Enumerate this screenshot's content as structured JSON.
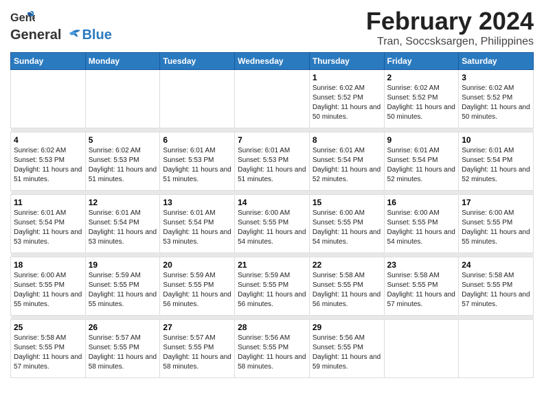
{
  "logo": {
    "general": "General",
    "blue": "Blue"
  },
  "title": "February 2024",
  "subtitle": "Tran, Soccsksargen, Philippines",
  "weekdays": [
    "Sunday",
    "Monday",
    "Tuesday",
    "Wednesday",
    "Thursday",
    "Friday",
    "Saturday"
  ],
  "weeks": [
    {
      "days": [
        {
          "num": "",
          "info": ""
        },
        {
          "num": "",
          "info": ""
        },
        {
          "num": "",
          "info": ""
        },
        {
          "num": "",
          "info": ""
        },
        {
          "num": "1",
          "info": "Sunrise: 6:02 AM\nSunset: 5:52 PM\nDaylight: 11 hours and 50 minutes."
        },
        {
          "num": "2",
          "info": "Sunrise: 6:02 AM\nSunset: 5:52 PM\nDaylight: 11 hours and 50 minutes."
        },
        {
          "num": "3",
          "info": "Sunrise: 6:02 AM\nSunset: 5:52 PM\nDaylight: 11 hours and 50 minutes."
        }
      ]
    },
    {
      "days": [
        {
          "num": "4",
          "info": "Sunrise: 6:02 AM\nSunset: 5:53 PM\nDaylight: 11 hours and 51 minutes."
        },
        {
          "num": "5",
          "info": "Sunrise: 6:02 AM\nSunset: 5:53 PM\nDaylight: 11 hours and 51 minutes."
        },
        {
          "num": "6",
          "info": "Sunrise: 6:01 AM\nSunset: 5:53 PM\nDaylight: 11 hours and 51 minutes."
        },
        {
          "num": "7",
          "info": "Sunrise: 6:01 AM\nSunset: 5:53 PM\nDaylight: 11 hours and 51 minutes."
        },
        {
          "num": "8",
          "info": "Sunrise: 6:01 AM\nSunset: 5:54 PM\nDaylight: 11 hours and 52 minutes."
        },
        {
          "num": "9",
          "info": "Sunrise: 6:01 AM\nSunset: 5:54 PM\nDaylight: 11 hours and 52 minutes."
        },
        {
          "num": "10",
          "info": "Sunrise: 6:01 AM\nSunset: 5:54 PM\nDaylight: 11 hours and 52 minutes."
        }
      ]
    },
    {
      "days": [
        {
          "num": "11",
          "info": "Sunrise: 6:01 AM\nSunset: 5:54 PM\nDaylight: 11 hours and 53 minutes."
        },
        {
          "num": "12",
          "info": "Sunrise: 6:01 AM\nSunset: 5:54 PM\nDaylight: 11 hours and 53 minutes."
        },
        {
          "num": "13",
          "info": "Sunrise: 6:01 AM\nSunset: 5:54 PM\nDaylight: 11 hours and 53 minutes."
        },
        {
          "num": "14",
          "info": "Sunrise: 6:00 AM\nSunset: 5:55 PM\nDaylight: 11 hours and 54 minutes."
        },
        {
          "num": "15",
          "info": "Sunrise: 6:00 AM\nSunset: 5:55 PM\nDaylight: 11 hours and 54 minutes."
        },
        {
          "num": "16",
          "info": "Sunrise: 6:00 AM\nSunset: 5:55 PM\nDaylight: 11 hours and 54 minutes."
        },
        {
          "num": "17",
          "info": "Sunrise: 6:00 AM\nSunset: 5:55 PM\nDaylight: 11 hours and 55 minutes."
        }
      ]
    },
    {
      "days": [
        {
          "num": "18",
          "info": "Sunrise: 6:00 AM\nSunset: 5:55 PM\nDaylight: 11 hours and 55 minutes."
        },
        {
          "num": "19",
          "info": "Sunrise: 5:59 AM\nSunset: 5:55 PM\nDaylight: 11 hours and 55 minutes."
        },
        {
          "num": "20",
          "info": "Sunrise: 5:59 AM\nSunset: 5:55 PM\nDaylight: 11 hours and 56 minutes."
        },
        {
          "num": "21",
          "info": "Sunrise: 5:59 AM\nSunset: 5:55 PM\nDaylight: 11 hours and 56 minutes."
        },
        {
          "num": "22",
          "info": "Sunrise: 5:58 AM\nSunset: 5:55 PM\nDaylight: 11 hours and 56 minutes."
        },
        {
          "num": "23",
          "info": "Sunrise: 5:58 AM\nSunset: 5:55 PM\nDaylight: 11 hours and 57 minutes."
        },
        {
          "num": "24",
          "info": "Sunrise: 5:58 AM\nSunset: 5:55 PM\nDaylight: 11 hours and 57 minutes."
        }
      ]
    },
    {
      "days": [
        {
          "num": "25",
          "info": "Sunrise: 5:58 AM\nSunset: 5:55 PM\nDaylight: 11 hours and 57 minutes."
        },
        {
          "num": "26",
          "info": "Sunrise: 5:57 AM\nSunset: 5:55 PM\nDaylight: 11 hours and 58 minutes."
        },
        {
          "num": "27",
          "info": "Sunrise: 5:57 AM\nSunset: 5:55 PM\nDaylight: 11 hours and 58 minutes."
        },
        {
          "num": "28",
          "info": "Sunrise: 5:56 AM\nSunset: 5:55 PM\nDaylight: 11 hours and 58 minutes."
        },
        {
          "num": "29",
          "info": "Sunrise: 5:56 AM\nSunset: 5:55 PM\nDaylight: 11 hours and 59 minutes."
        },
        {
          "num": "",
          "info": ""
        },
        {
          "num": "",
          "info": ""
        }
      ]
    }
  ]
}
